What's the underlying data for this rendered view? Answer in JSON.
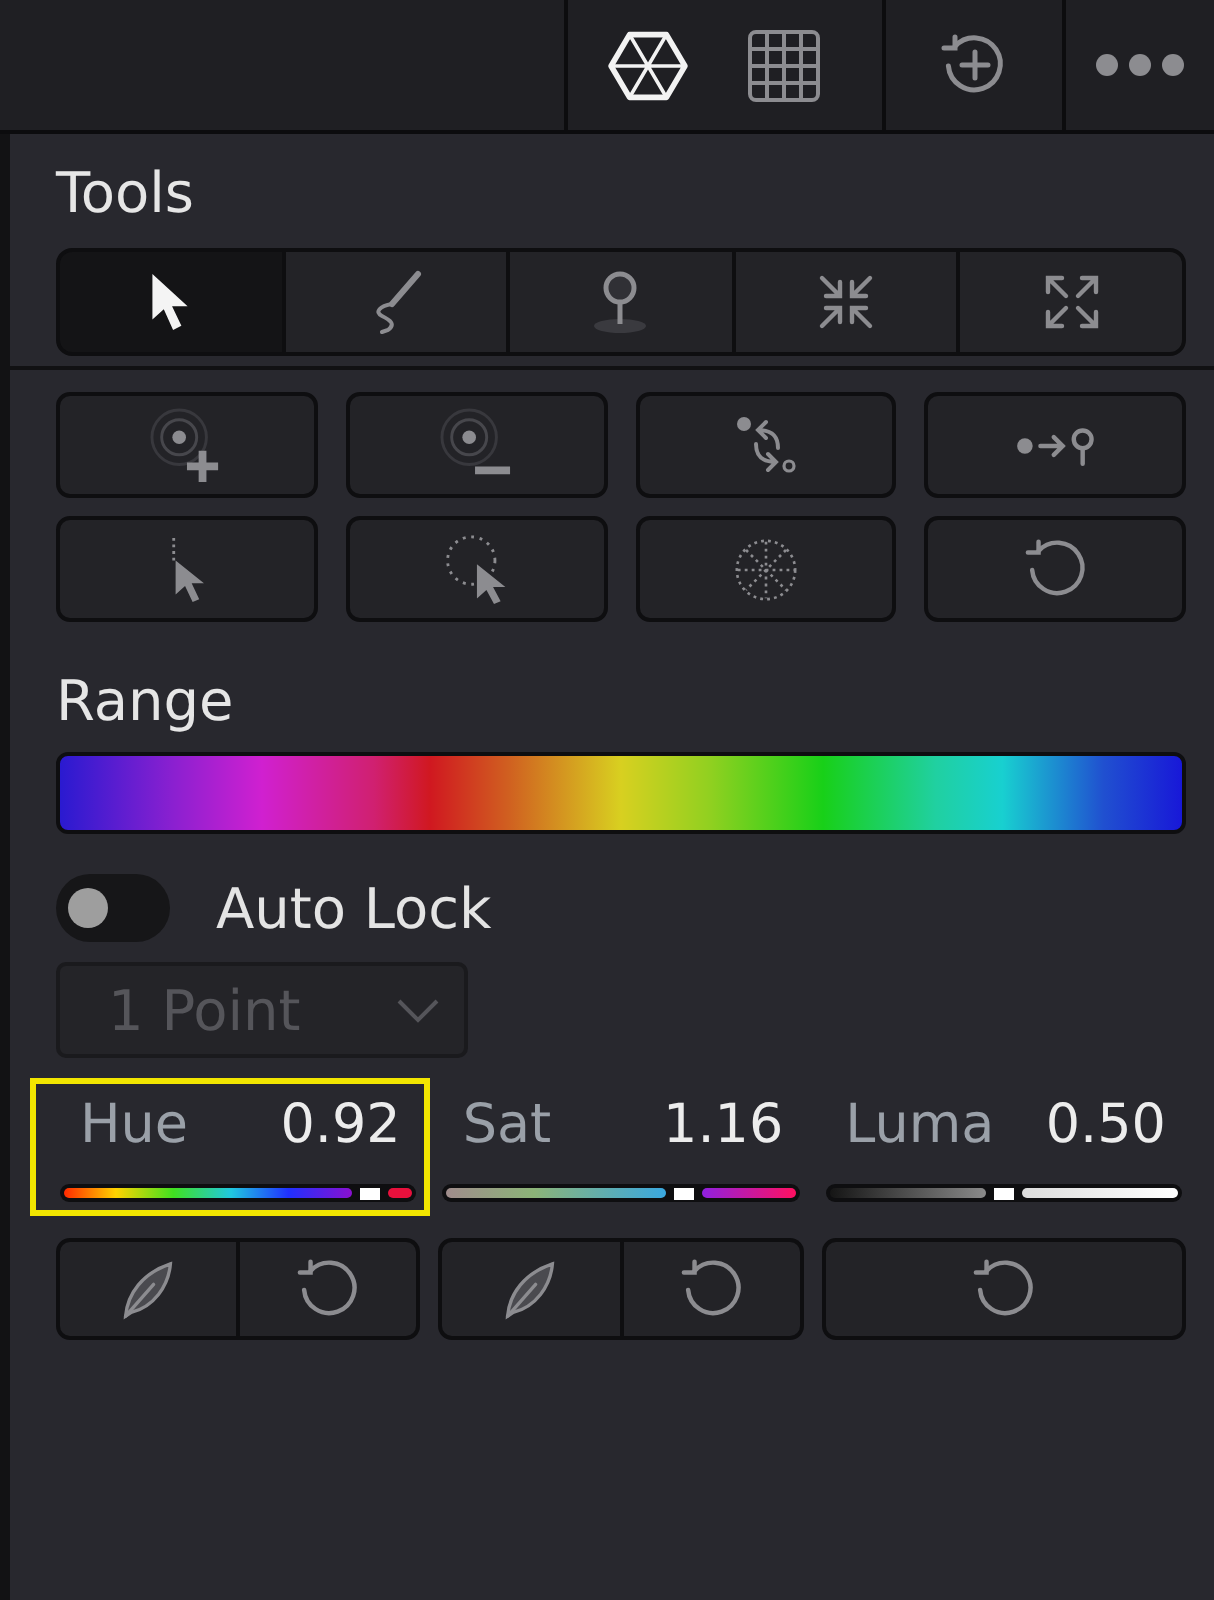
{
  "top_bar": {
    "view_modes": [
      {
        "kind": "hexagon",
        "selected": true
      },
      {
        "kind": "grid",
        "selected": false
      }
    ],
    "actions": [
      {
        "kind": "history_add"
      },
      {
        "kind": "more"
      }
    ]
  },
  "tools": {
    "title": "Tools",
    "modes": [
      {
        "kind": "pointer",
        "selected": true
      },
      {
        "kind": "draw",
        "selected": false
      },
      {
        "kind": "pin",
        "selected": false
      },
      {
        "kind": "collapse",
        "selected": false
      },
      {
        "kind": "expand",
        "selected": false
      }
    ],
    "actions": [
      {
        "kind": "add_point"
      },
      {
        "kind": "remove_point"
      },
      {
        "kind": "swap"
      },
      {
        "kind": "move_to_pin"
      },
      {
        "kind": "select_line"
      },
      {
        "kind": "select_circle"
      },
      {
        "kind": "radial"
      },
      {
        "kind": "reset"
      }
    ]
  },
  "range": {
    "title": "Range"
  },
  "auto_lock": {
    "label": "Auto Lock",
    "on": false
  },
  "points_dropdown": {
    "value": "1 Point",
    "disabled": true
  },
  "params": [
    {
      "kind": "hue",
      "label": "Hue",
      "value": "0.92",
      "level": 0.88,
      "highlighted": true,
      "buttons": [
        {
          "kind": "picker"
        },
        {
          "kind": "reset"
        }
      ]
    },
    {
      "kind": "sat",
      "label": "Sat",
      "value": "1.16",
      "level": 0.68,
      "highlighted": false,
      "buttons": [
        {
          "kind": "picker"
        },
        {
          "kind": "reset"
        }
      ]
    },
    {
      "kind": "luma",
      "label": "Luma",
      "value": "0.50",
      "level": 0.5,
      "highlighted": false,
      "buttons": [
        {
          "kind": "reset"
        }
      ]
    }
  ]
}
